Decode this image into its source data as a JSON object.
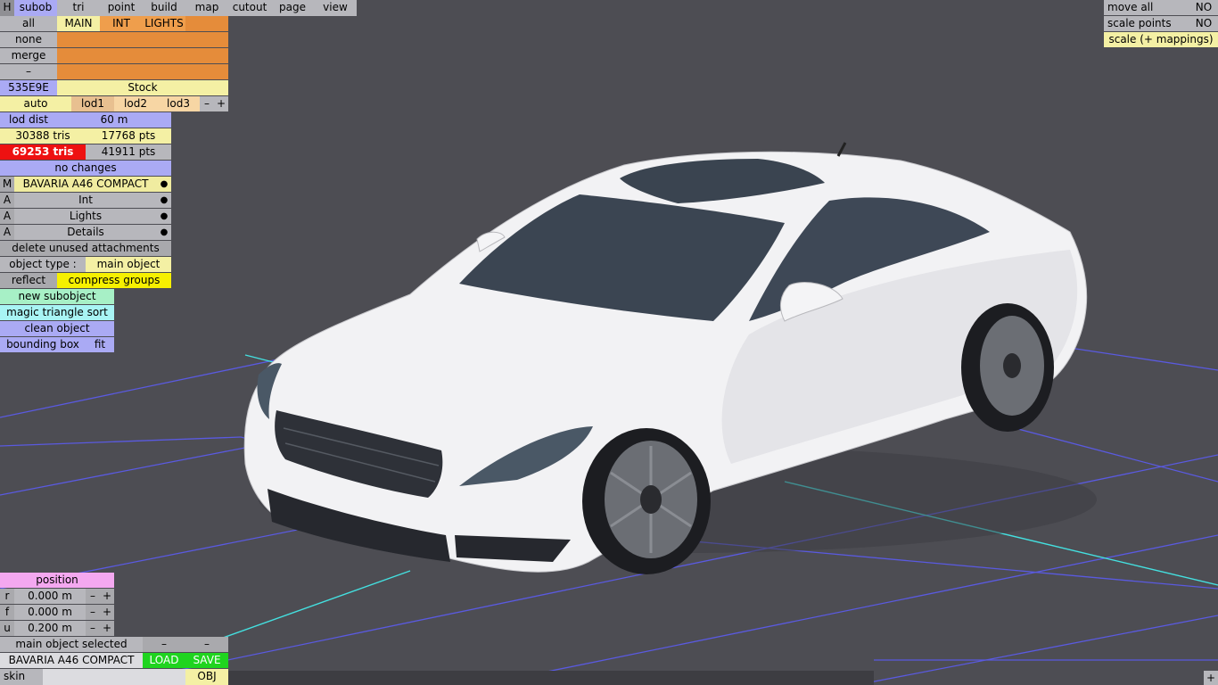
{
  "top_tabs": {
    "h": "H",
    "subob": "subob",
    "tri": "tri",
    "point": "point",
    "build": "build",
    "map": "map",
    "cutout": "cutout",
    "page": "page",
    "view": "view"
  },
  "groups": {
    "all": "all",
    "none": "none",
    "merge": "merge",
    "minus": "–",
    "main": "MAIN",
    "int": "INT",
    "lights": "LIGHTS"
  },
  "variant": {
    "id": "535E9E",
    "name": "Stock"
  },
  "lod": {
    "auto": "auto",
    "lod1": "lod1",
    "lod2": "lod2",
    "lod3": "lod3",
    "minus": "–",
    "plus": "+",
    "dist_label": "lod dist",
    "dist_value": "60 m"
  },
  "stats": {
    "tris1": "30388 tris",
    "pts1": "17768 pts",
    "tris2": "69253 tris",
    "pts2": "41911 pts",
    "changes": "no changes"
  },
  "parts": [
    {
      "flag": "M",
      "name": "BAVARIA A46 COMPACT",
      "dot": "●"
    },
    {
      "flag": "A",
      "name": "Int",
      "dot": "●"
    },
    {
      "flag": "A",
      "name": "Lights",
      "dot": "●"
    },
    {
      "flag": "A",
      "name": "Details",
      "dot": "●"
    }
  ],
  "actions": {
    "delete_unused": "delete unused attachments",
    "object_type_label": "object type :",
    "object_type_value": "main object",
    "reflect": "reflect",
    "compress": "compress groups",
    "new_subobject": "new subobject",
    "magic_sort": "magic triangle sort",
    "clean": "clean object",
    "bounding_box": "bounding box",
    "fit": "fit"
  },
  "top_right": {
    "move_all": "move all",
    "move_all_val": "NO",
    "scale_points": "scale points",
    "scale_points_val": "NO",
    "scale_mappings": "scale (+ mappings)"
  },
  "position": {
    "title": "position",
    "rows": [
      {
        "axis": "r",
        "value": "0.000 m"
      },
      {
        "axis": "f",
        "value": "0.000 m"
      },
      {
        "axis": "u",
        "value": "0.200 m"
      }
    ],
    "minus": "–",
    "plus": "+"
  },
  "bottom": {
    "selected": "main object selected",
    "dash1": "–",
    "dash2": "–",
    "model_name": "BAVARIA A46 COMPACT",
    "load": "LOAD",
    "save": "SAVE",
    "skin": "skin",
    "obj": "OBJ",
    "corner_plus": "+"
  }
}
